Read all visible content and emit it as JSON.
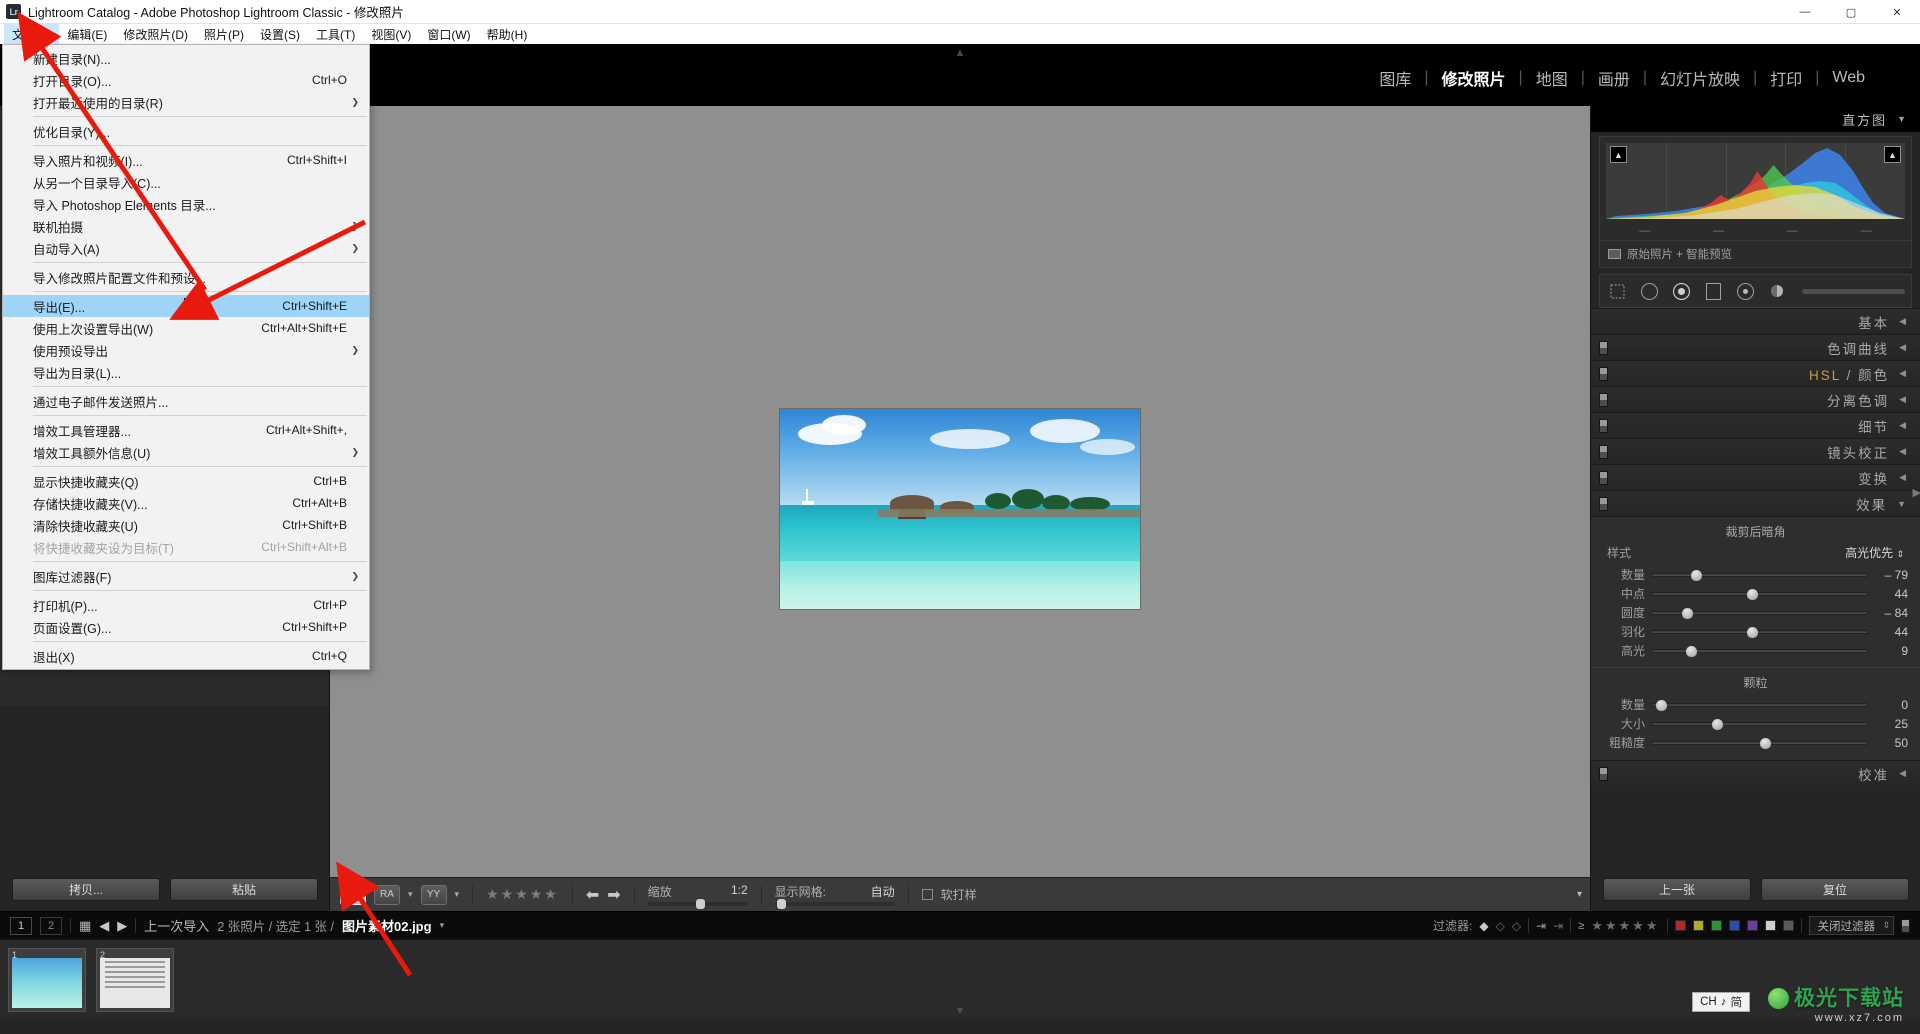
{
  "window": {
    "title": "Lightroom Catalog - Adobe Photoshop Lightroom Classic - 修改照片",
    "logo": "Lr",
    "minimize": "—",
    "maximize": "▢",
    "close": "✕"
  },
  "menubar": [
    {
      "label": "文件(F)",
      "active": true
    },
    {
      "label": "编辑(E)",
      "active": false
    },
    {
      "label": "修改照片(D)",
      "active": false
    },
    {
      "label": "照片(P)",
      "active": false
    },
    {
      "label": "设置(S)",
      "active": false
    },
    {
      "label": "工具(T)",
      "active": false
    },
    {
      "label": "视图(V)",
      "active": false
    },
    {
      "label": "窗口(W)",
      "active": false
    },
    {
      "label": "帮助(H)",
      "active": false
    }
  ],
  "file_menu": [
    {
      "label": "新建目录(N)...",
      "accel": "",
      "sel": false,
      "disabled": false,
      "sub": false
    },
    {
      "label": "打开目录(O)...",
      "accel": "Ctrl+O",
      "sel": false,
      "disabled": false,
      "sub": false
    },
    {
      "label": "打开最近使用的目录(R)",
      "accel": "",
      "sel": false,
      "disabled": false,
      "sub": true
    },
    {
      "sep": true
    },
    {
      "label": "优化目录(Y)...",
      "accel": "",
      "sel": false,
      "disabled": false,
      "sub": false
    },
    {
      "sep": true
    },
    {
      "label": "导入照片和视频(I)...",
      "accel": "Ctrl+Shift+I",
      "sel": false,
      "disabled": false,
      "sub": false
    },
    {
      "label": "从另一个目录导入(C)...",
      "accel": "",
      "sel": false,
      "disabled": false,
      "sub": false
    },
    {
      "label": "导入 Photoshop Elements 目录...",
      "accel": "",
      "sel": false,
      "disabled": false,
      "sub": false
    },
    {
      "label": "联机拍摄",
      "accel": "",
      "sel": false,
      "disabled": false,
      "sub": true
    },
    {
      "label": "自动导入(A)",
      "accel": "",
      "sel": false,
      "disabled": false,
      "sub": true
    },
    {
      "sep": true
    },
    {
      "label": "导入修改照片配置文件和预设...",
      "accel": "",
      "sel": false,
      "disabled": false,
      "sub": false
    },
    {
      "sep": true
    },
    {
      "label": "导出(E)...",
      "accel": "Ctrl+Shift+E",
      "sel": true,
      "disabled": false,
      "sub": false
    },
    {
      "label": "使用上次设置导出(W)",
      "accel": "Ctrl+Alt+Shift+E",
      "sel": false,
      "disabled": false,
      "sub": false
    },
    {
      "label": "使用预设导出",
      "accel": "",
      "sel": false,
      "disabled": false,
      "sub": true
    },
    {
      "label": "导出为目录(L)...",
      "accel": "",
      "sel": false,
      "disabled": false,
      "sub": false
    },
    {
      "sep": true
    },
    {
      "label": "通过电子邮件发送照片...",
      "accel": "",
      "sel": false,
      "disabled": false,
      "sub": false
    },
    {
      "sep": true
    },
    {
      "label": "增效工具管理器...",
      "accel": "Ctrl+Alt+Shift+,",
      "sel": false,
      "disabled": false,
      "sub": false
    },
    {
      "label": "增效工具额外信息(U)",
      "accel": "",
      "sel": false,
      "disabled": false,
      "sub": true
    },
    {
      "sep": true
    },
    {
      "label": "显示快捷收藏夹(Q)",
      "accel": "Ctrl+B",
      "sel": false,
      "disabled": false,
      "sub": false
    },
    {
      "label": "存储快捷收藏夹(V)...",
      "accel": "Ctrl+Alt+B",
      "sel": false,
      "disabled": false,
      "sub": false
    },
    {
      "label": "清除快捷收藏夹(U)",
      "accel": "Ctrl+Shift+B",
      "sel": false,
      "disabled": false,
      "sub": false
    },
    {
      "label": "将快捷收藏夹设为目标(T)",
      "accel": "Ctrl+Shift+Alt+B",
      "sel": false,
      "disabled": true,
      "sub": false
    },
    {
      "sep": true
    },
    {
      "label": "图库过滤器(F)",
      "accel": "",
      "sel": false,
      "disabled": false,
      "sub": true
    },
    {
      "sep": true
    },
    {
      "label": "打印机(P)...",
      "accel": "Ctrl+P",
      "sel": false,
      "disabled": false,
      "sub": false
    },
    {
      "label": "页面设置(G)...",
      "accel": "Ctrl+Shift+P",
      "sel": false,
      "disabled": false,
      "sub": false
    },
    {
      "sep": true
    },
    {
      "label": "退出(X)",
      "accel": "Ctrl+Q",
      "sel": false,
      "disabled": false,
      "sub": false
    }
  ],
  "modules": [
    {
      "label": "图库",
      "active": false
    },
    {
      "label": "修改照片",
      "active": true
    },
    {
      "label": "地图",
      "active": false
    },
    {
      "label": "画册",
      "active": false
    },
    {
      "label": "幻灯片放映",
      "active": false
    },
    {
      "label": "打印",
      "active": false
    },
    {
      "label": "Web",
      "active": false
    }
  ],
  "left_panel": {
    "copy_button": "拷贝...",
    "paste_button": "粘贴"
  },
  "right_panel": {
    "histogram": {
      "title": "直方图",
      "footer": "原始照片 + 智能预览",
      "ticks": [
        "—",
        "—",
        "—",
        "—"
      ]
    },
    "sections": [
      {
        "label": "基本",
        "caret": "◀",
        "hsl": false
      },
      {
        "label": "色调曲线",
        "caret": "◀",
        "hsl": false
      },
      {
        "label": "HSL / 颜色",
        "caret": "◀",
        "hsl": true
      },
      {
        "label": "分离色调",
        "caret": "◀",
        "hsl": false
      },
      {
        "label": "细节",
        "caret": "◀",
        "hsl": false
      },
      {
        "label": "镜头校正",
        "caret": "◀",
        "hsl": false
      },
      {
        "label": "变换",
        "caret": "◀",
        "hsl": false
      },
      {
        "label": "效果",
        "caret": "▼",
        "hsl": false
      }
    ],
    "effects": {
      "vignette_title": "裁剪后暗角",
      "style_label": "样式",
      "style_value": "高光优先",
      "vignette_sliders": [
        {
          "name": "数量",
          "value": "– 79",
          "pos": 18
        },
        {
          "name": "中点",
          "value": "44",
          "pos": 44
        },
        {
          "name": "圆度",
          "value": "– 84",
          "pos": 14
        },
        {
          "name": "羽化",
          "value": "44",
          "pos": 44
        },
        {
          "name": "高光",
          "value": "9",
          "pos": 16
        }
      ],
      "grain_title": "颗粒",
      "grain_sliders": [
        {
          "name": "数量",
          "value": "0",
          "pos": 2
        },
        {
          "name": "大小",
          "value": "25",
          "pos": 28
        },
        {
          "name": "粗糙度",
          "value": "50",
          "pos": 50
        }
      ]
    },
    "calibration_label": "校准",
    "calibration_caret": "◀",
    "prev_button": "上一张",
    "reset_button": "复位"
  },
  "toolbar": {
    "view_loupe": "▣",
    "view_before_after": "RA",
    "view_yy": "YY",
    "stars": "★★★★★",
    "prev_arrow": "⬅",
    "next_arrow": "➡",
    "zoom_label": "缩放",
    "zoom_value": "1:2",
    "grid_label": "显示网格:",
    "grid_value": "自动",
    "softproof_label": "软打样",
    "softproof_checked": false,
    "caret": "▾"
  },
  "filmstrip_bar": {
    "source_1": "1",
    "source_2": "2",
    "grid_icon": "▦",
    "back_arrow": "◀",
    "forward_arrow": "▶",
    "breadcrumb_source": "上一次导入",
    "breadcrumb_count": "2 张照片 / 选定 1 张 /",
    "breadcrumb_file": "图片素材02.jpg",
    "breadcrumb_caret": "▾",
    "filter_label": "过滤器:",
    "flag_icons": [
      "◆",
      "◇",
      "◇"
    ],
    "attr_icons": [
      "⇥",
      "⇥"
    ],
    "rating_op": "≥",
    "rating_stars": "★★★★★",
    "color_chips": [
      "#b3282d",
      "#b0a827",
      "#2f8f3c",
      "#2b4fb0",
      "#6a3fa0",
      "#cfcfcf",
      "#5a5a5a"
    ],
    "filter_select": "关闭过滤器"
  },
  "filmstrip": {
    "thumbs": [
      {
        "num": "1",
        "type": "photo"
      },
      {
        "num": "2",
        "type": "doc"
      }
    ]
  },
  "ime": {
    "lang": "CH",
    "note": "♪",
    "mode": "简"
  },
  "watermark": {
    "main": "极光下载站",
    "sub": "www.xz7.com"
  },
  "colors": {
    "accent": "#9fd4f9",
    "menu_active": "#cce8ff",
    "annotation_red": "#e81a0e",
    "panel_bg": "#252525",
    "canvas_bg": "#8f8f8f"
  }
}
